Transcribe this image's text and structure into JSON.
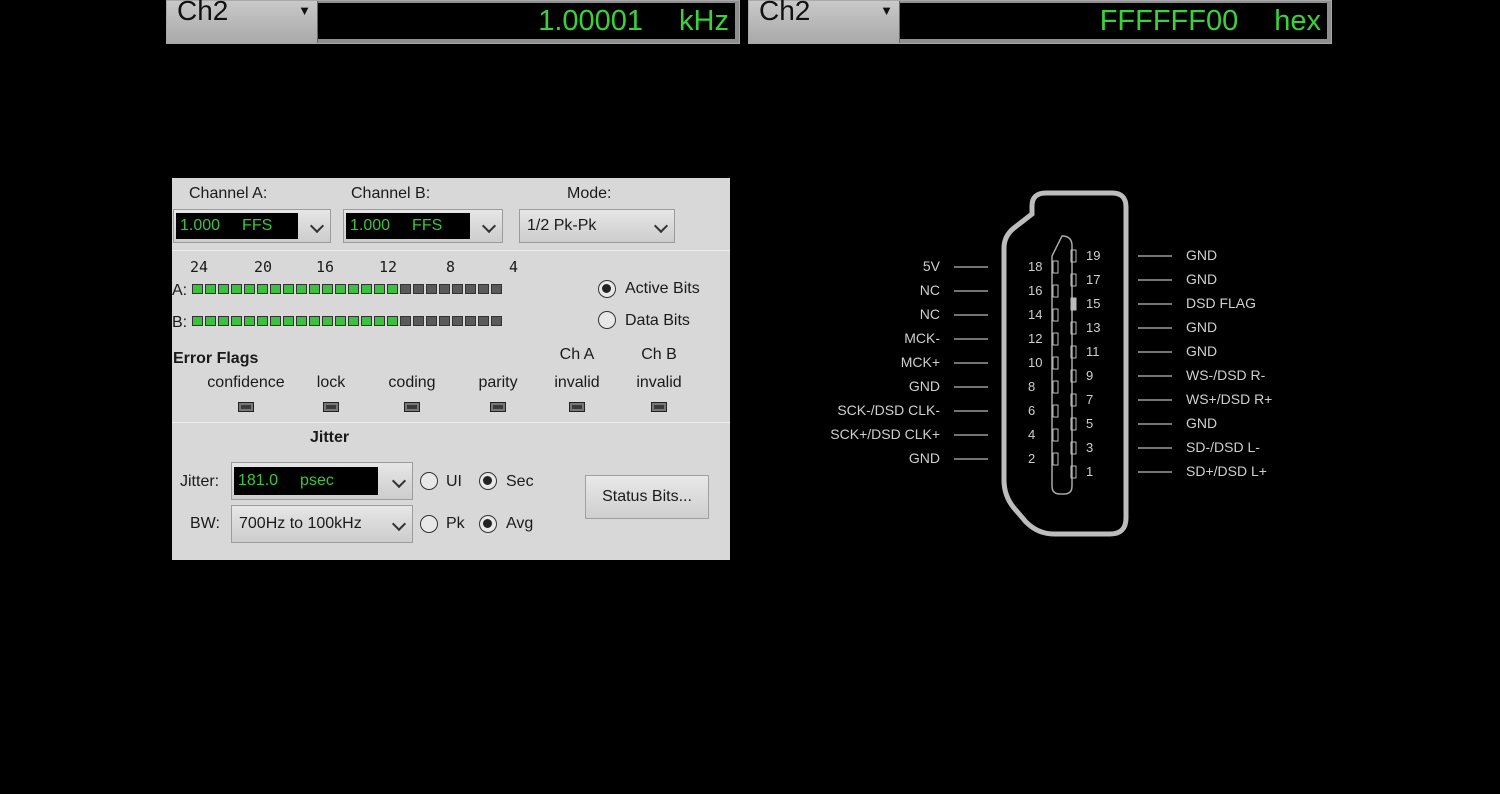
{
  "readouts": [
    {
      "channel": "Ch2",
      "arrow": "▼",
      "value": "1.00001",
      "unit": "kHz"
    },
    {
      "channel": "Ch2",
      "arrow": "▼",
      "value": "FFFFFF00",
      "unit": "hex"
    }
  ],
  "panel": {
    "channel_a": {
      "label": "Channel A:",
      "value": "1.000",
      "unit": "FFS"
    },
    "channel_b": {
      "label": "Channel B:",
      "value": "1.000",
      "unit": "FFS"
    },
    "mode": {
      "label": "Mode:",
      "value": "1/2 Pk-Pk"
    },
    "bit_scale": [
      "24",
      "20",
      "16",
      "12",
      "8",
      "4"
    ],
    "row_a_label": "A:",
    "row_b_label": "B:",
    "bits_active": 16,
    "bits_total": 24,
    "active_bits_label": "Active Bits",
    "data_bits_label": "Data Bits",
    "error_flags": {
      "title": "Error Flags",
      "flags": [
        {
          "top": "",
          "bottom": "confidence"
        },
        {
          "top": "",
          "bottom": "lock"
        },
        {
          "top": "",
          "bottom": "coding"
        },
        {
          "top": "",
          "bottom": "parity"
        },
        {
          "top": "Ch A",
          "bottom": "invalid"
        },
        {
          "top": "Ch B",
          "bottom": "invalid"
        }
      ]
    },
    "jitter": {
      "title": "Jitter",
      "label": "Jitter:",
      "value": "181.0",
      "unit": "psec",
      "bw_label": "BW:",
      "bw_value": "700Hz to 100kHz",
      "ui_label": "UI",
      "sec_label": "Sec",
      "pk_label": "Pk",
      "avg_label": "Avg",
      "status_button": "Status Bits..."
    }
  },
  "pinout": {
    "left": [
      {
        "num": "18",
        "label": "5V"
      },
      {
        "num": "16",
        "label": "NC"
      },
      {
        "num": "14",
        "label": "NC"
      },
      {
        "num": "12",
        "label": "MCK-"
      },
      {
        "num": "10",
        "label": "MCK+"
      },
      {
        "num": "8",
        "label": "GND"
      },
      {
        "num": "6",
        "label": "SCK-/DSD CLK-"
      },
      {
        "num": "4",
        "label": "SCK+/DSD CLK+"
      },
      {
        "num": "2",
        "label": "GND"
      }
    ],
    "right": [
      {
        "num": "19",
        "label": "GND"
      },
      {
        "num": "17",
        "label": "GND"
      },
      {
        "num": "15",
        "label": "DSD FLAG"
      },
      {
        "num": "13",
        "label": "GND"
      },
      {
        "num": "11",
        "label": "GND"
      },
      {
        "num": "9",
        "label": "WS-/DSD R-"
      },
      {
        "num": "7",
        "label": "WS+/DSD R+"
      },
      {
        "num": "5",
        "label": "GND"
      },
      {
        "num": "3",
        "label": "SD-/DSD L-"
      },
      {
        "num": "1",
        "label": "SD+/DSD L+"
      }
    ]
  }
}
